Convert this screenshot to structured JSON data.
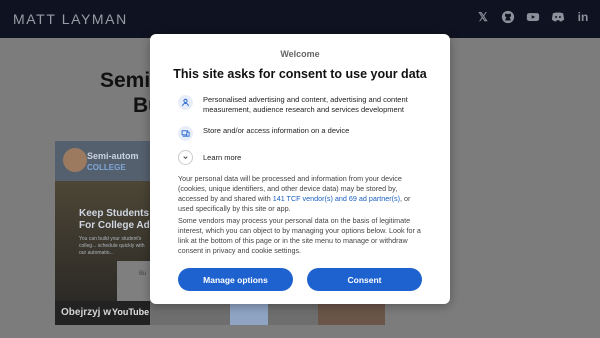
{
  "header": {
    "brand": "MATT LAYMAN",
    "social": [
      {
        "name": "x-icon",
        "glyph": "𝕏"
      },
      {
        "name": "github-icon",
        "glyph": ""
      },
      {
        "name": "youtube-icon",
        "glyph": ""
      },
      {
        "name": "discord-icon",
        "glyph": ""
      },
      {
        "name": "linkedin-icon",
        "glyph": "in"
      }
    ]
  },
  "page": {
    "headline_line1": "Semi",
    "headline_line2": "Bu",
    "video": {
      "title": "Semi-autom",
      "subtitle": "COLLEGE",
      "hero_line1": "Keep Students",
      "hero_line2": "For College Ad",
      "hero_small": "You can build your student's colleg... schedule quickly with our automatio...",
      "card_text": "Bu",
      "watch_label": "Obejrzyj w",
      "youtube_label": "YouTube"
    }
  },
  "consent": {
    "welcome": "Welcome",
    "title": "This site asks for consent to use your data",
    "purposes": [
      "Personalised advertising and content, advertising and content measurement, audience research and services development",
      "Store and/or access information on a device"
    ],
    "learn_more": "Learn more",
    "body1_pre": "Your personal data will be processed and information from your device (cookies, unique identifiers, and other device data) may be stored by, accessed by and shared with ",
    "body1_link": "141 TCF vendor(s) and 69 ad partner(s)",
    "body1_post": ", or used specifically by this site or app.",
    "body2": "Some vendors may process your personal data on the basis of legitimate interest, which you can object to by managing your options below. Look for a link at the bottom of this page or in the site menu to manage or withdraw consent in privacy and cookie settings.",
    "manage_label": "Manage options",
    "consent_label": "Consent",
    "accent_color": "#1e62d0"
  }
}
